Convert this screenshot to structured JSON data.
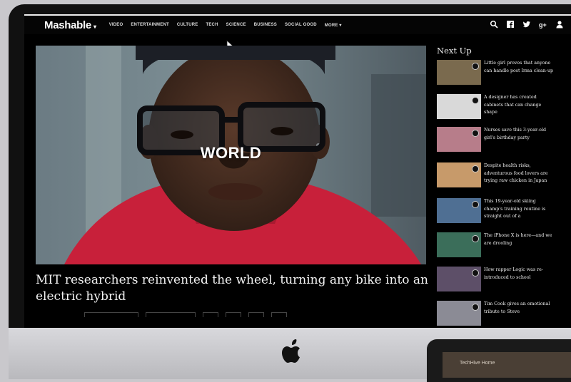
{
  "site": {
    "logo": "Mashable"
  },
  "nav": {
    "items": [
      "VIDEO",
      "ENTERTAINMENT",
      "CULTURE",
      "TECH",
      "SCIENCE",
      "BUSINESS",
      "SOCIAL GOOD",
      "MORE"
    ]
  },
  "hero": {
    "label": "WORLD",
    "headline": "MIT researchers reinvented the wheel, turning any bike into an electric hybrid"
  },
  "sidebar": {
    "title": "Next Up",
    "items": [
      {
        "text": "Little girl proves that anyone can handle post Irma clean-up",
        "thumb": "#7a6a4e"
      },
      {
        "text": "A designer has created cabinets that can change shape",
        "thumb": "#d9d9d9"
      },
      {
        "text": "Nurses save this 3-year-old girl's birthday party",
        "thumb": "#b77d8a"
      },
      {
        "text": "Despite health risks, adventurous food lovers are trying raw chicken in Japan",
        "thumb": "#c79a6a"
      },
      {
        "text": "This 19-year-old skiing champ's training routine is straight out of a",
        "thumb": "#4f6f93"
      },
      {
        "text": "The iPhone X is here—and we are drooling",
        "thumb": "#3b6e5a"
      },
      {
        "text": "How rapper Logic was re-introduced to school",
        "thumb": "#5d4f68"
      },
      {
        "text": "Tim Cook gives an emotional tribute to Steve",
        "thumb": "#8b8b95"
      }
    ]
  },
  "laptop": {
    "text": "TechHive Home"
  },
  "colors": {
    "screen_bg": "#000000",
    "hero_shirt": "#c8203a",
    "bezel": "#111111"
  }
}
